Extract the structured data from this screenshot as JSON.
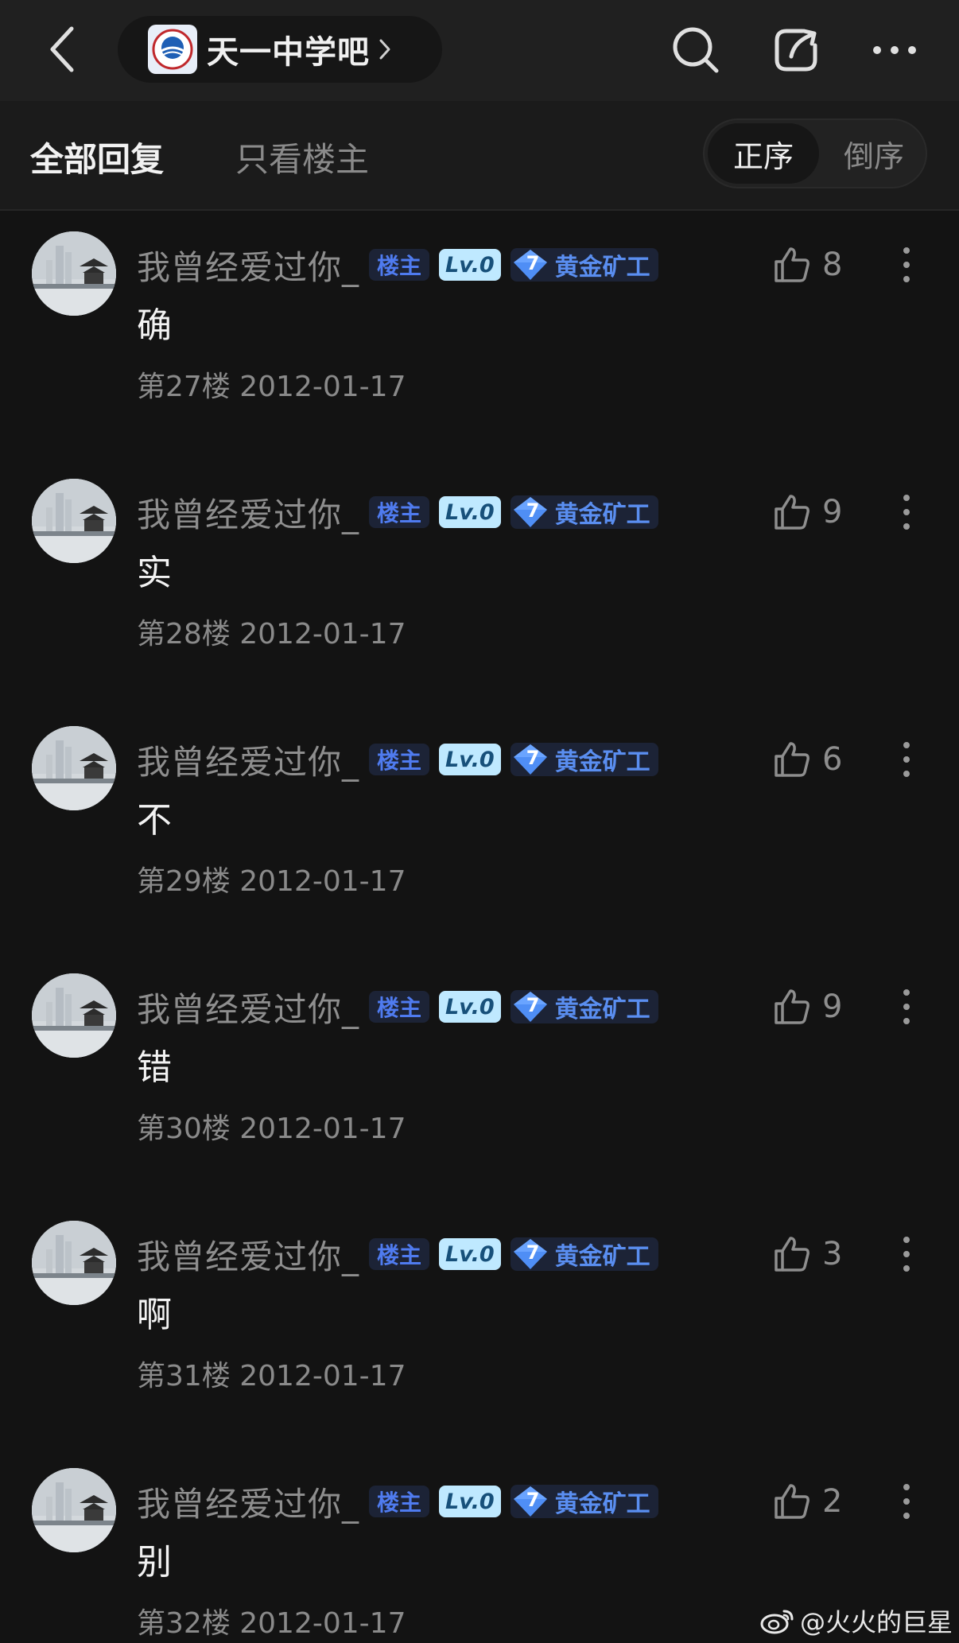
{
  "nav": {
    "forum_name": "天一中学吧"
  },
  "filter": {
    "tab_all": "全部回复",
    "tab_op_only": "只看楼主",
    "order_asc": "正序",
    "order_desc": "倒序"
  },
  "colors": {
    "background": "#131313",
    "topbar": "#202020",
    "accent_blue": "#4f7bef",
    "level_badge_bg": "#bfe9ff"
  },
  "posts": [
    {
      "username": "我曾经爱过你_",
      "op_badge": "楼主",
      "level": "Lv.0",
      "rank_num": "7",
      "rank_title": "黄金矿工",
      "likes": "8",
      "content": "确",
      "meta": "第27楼 2012-01-17"
    },
    {
      "username": "我曾经爱过你_",
      "op_badge": "楼主",
      "level": "Lv.0",
      "rank_num": "7",
      "rank_title": "黄金矿工",
      "likes": "9",
      "content": "实",
      "meta": "第28楼 2012-01-17"
    },
    {
      "username": "我曾经爱过你_",
      "op_badge": "楼主",
      "level": "Lv.0",
      "rank_num": "7",
      "rank_title": "黄金矿工",
      "likes": "6",
      "content": "不",
      "meta": "第29楼 2012-01-17"
    },
    {
      "username": "我曾经爱过你_",
      "op_badge": "楼主",
      "level": "Lv.0",
      "rank_num": "7",
      "rank_title": "黄金矿工",
      "likes": "9",
      "content": "错",
      "meta": "第30楼 2012-01-17"
    },
    {
      "username": "我曾经爱过你_",
      "op_badge": "楼主",
      "level": "Lv.0",
      "rank_num": "7",
      "rank_title": "黄金矿工",
      "likes": "3",
      "content": "啊",
      "meta": "第31楼 2012-01-17"
    },
    {
      "username": "我曾经爱过你_",
      "op_badge": "楼主",
      "level": "Lv.0",
      "rank_num": "7",
      "rank_title": "黄金矿工",
      "likes": "2",
      "content": "别",
      "meta": "第32楼 2012-01-17"
    }
  ],
  "watermark": "@火火的巨星"
}
